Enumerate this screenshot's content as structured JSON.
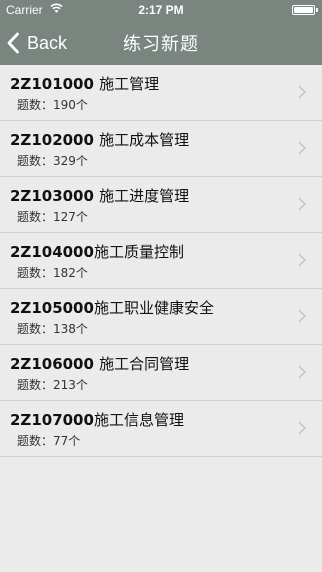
{
  "status_bar": {
    "carrier": "Carrier",
    "time": "2:17 PM"
  },
  "nav": {
    "back_label": "Back",
    "title": "练习新题"
  },
  "count_prefix": "题数：",
  "items": [
    {
      "code": "2Z101000 ",
      "name": "施工管理",
      "count": "190个"
    },
    {
      "code": "2Z102000 ",
      "name": "施工成本管理",
      "count": "329个"
    },
    {
      "code": "2Z103000 ",
      "name": "施工进度管理",
      "count": "127个"
    },
    {
      "code": "2Z104000",
      "name": "施工质量控制",
      "count": "182个"
    },
    {
      "code": "2Z105000",
      "name": "施工职业健康安全",
      "count": "138个"
    },
    {
      "code": "2Z106000 ",
      "name": "施工合同管理",
      "count": "213个"
    },
    {
      "code": "2Z107000",
      "name": "施工信息管理",
      "count": "77个"
    }
  ],
  "colors": {
    "nav_background": "#7a8580",
    "page_background": "#ebebeb"
  },
  "icons": [
    "wifi-icon",
    "battery-icon",
    "back-chevron-icon",
    "chevron-right-icon"
  ]
}
